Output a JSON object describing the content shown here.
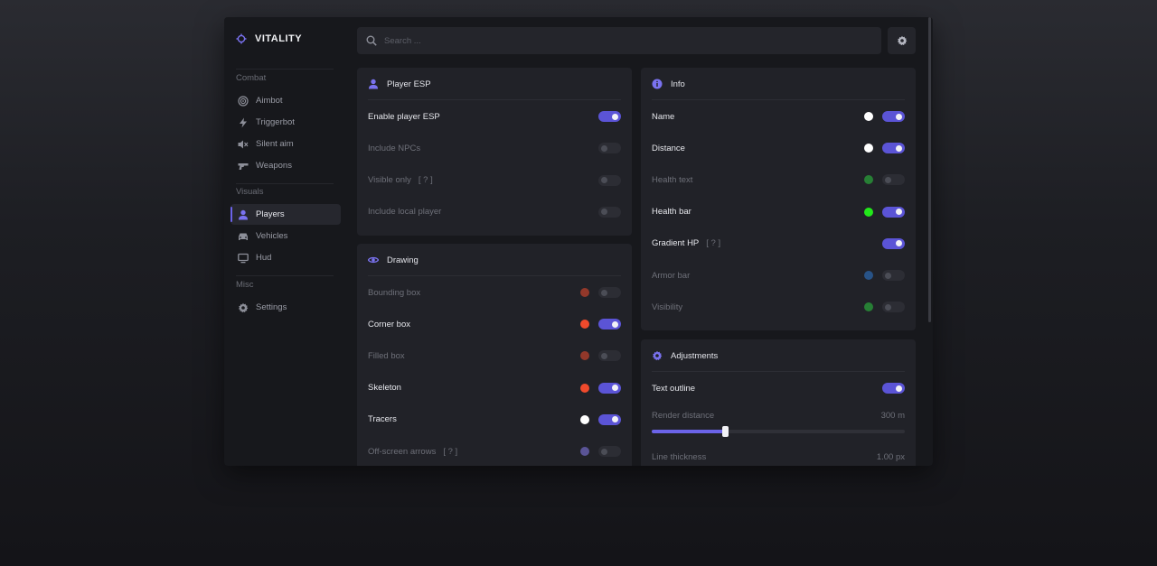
{
  "brand": {
    "name": "VITALITY"
  },
  "search": {
    "placeholder": "Search ..."
  },
  "sidebar": {
    "sections": [
      {
        "title": "Combat",
        "items": [
          {
            "label": "Aimbot",
            "icon": "target-icon"
          },
          {
            "label": "Triggerbot",
            "icon": "lightning-icon"
          },
          {
            "label": "Silent aim",
            "icon": "mute-icon"
          },
          {
            "label": "Weapons",
            "icon": "gun-icon"
          }
        ]
      },
      {
        "title": "Visuals",
        "items": [
          {
            "label": "Players",
            "icon": "user-icon",
            "active": true
          },
          {
            "label": "Vehicles",
            "icon": "car-icon"
          },
          {
            "label": "Hud",
            "icon": "monitor-icon"
          }
        ]
      },
      {
        "title": "Misc",
        "items": [
          {
            "label": "Settings",
            "icon": "gear-icon"
          }
        ]
      }
    ]
  },
  "player_esp": {
    "title": "Player ESP",
    "rows": [
      {
        "label": "Enable player ESP",
        "enabled": true
      },
      {
        "label": "Include NPCs",
        "enabled": false
      },
      {
        "label": "Visible only",
        "hint": "[ ? ]",
        "enabled": false
      },
      {
        "label": "Include local player",
        "enabled": false
      }
    ]
  },
  "drawing": {
    "title": "Drawing",
    "rows": [
      {
        "label": "Bounding box",
        "color": "#f04a2c",
        "enabled": false
      },
      {
        "label": "Corner box",
        "color": "#f04a2c",
        "enabled": true
      },
      {
        "label": "Filled box",
        "color": "#f04a2c",
        "enabled": false
      },
      {
        "label": "Skeleton",
        "color": "#f04a2c",
        "enabled": true
      },
      {
        "label": "Tracers",
        "color": "#ffffff",
        "enabled": true
      },
      {
        "label": "Off-screen arrows",
        "hint": "[ ? ]",
        "color": "#8a7ef0",
        "enabled": false
      }
    ]
  },
  "info": {
    "title": "Info",
    "rows": [
      {
        "label": "Name",
        "color": "#ffffff",
        "enabled": true
      },
      {
        "label": "Distance",
        "color": "#ffffff",
        "enabled": true
      },
      {
        "label": "Health text",
        "color": "#2ecc40",
        "enabled": false
      },
      {
        "label": "Health bar",
        "color": "#22e81a",
        "enabled": true
      },
      {
        "label": "Gradient HP",
        "hint": "[ ? ]",
        "color": null,
        "enabled": true
      },
      {
        "label": "Armor bar",
        "color": "#2f7bd6",
        "enabled": false
      },
      {
        "label": "Visibility",
        "color": "#2ecc40",
        "enabled": false
      }
    ]
  },
  "adjustments": {
    "title": "Adjustments",
    "text_outline": {
      "label": "Text outline",
      "enabled": true
    },
    "render_distance": {
      "label": "Render distance",
      "value_text": "300 m",
      "fraction": 0.29
    },
    "line_thickness": {
      "label": "Line thickness",
      "value_text": "1.00 px"
    }
  }
}
